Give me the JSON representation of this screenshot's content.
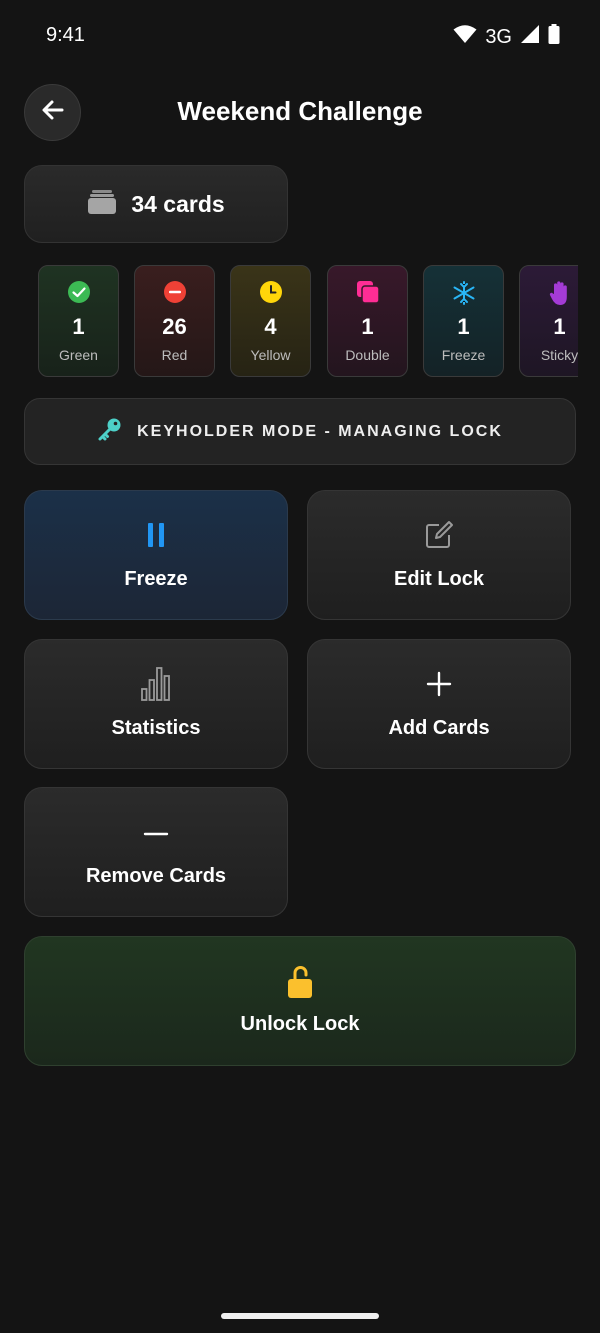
{
  "status": {
    "time": "9:41",
    "network": "3G"
  },
  "header": {
    "title": "Weekend Challenge"
  },
  "deck": {
    "count_label": "34 cards"
  },
  "chips": [
    {
      "count": "1",
      "label": "Green",
      "icon": "check-circle-icon",
      "color": "#3cba54"
    },
    {
      "count": "26",
      "label": "Red",
      "icon": "minus-circle-icon",
      "color": "#ef4136"
    },
    {
      "count": "4",
      "label": "Yellow",
      "icon": "clock-icon",
      "color": "#ffd60a"
    },
    {
      "count": "1",
      "label": "Double",
      "icon": "double-card-icon",
      "color": "#ff2d95"
    },
    {
      "count": "1",
      "label": "Freeze",
      "icon": "snowflake-icon",
      "color": "#29b6f6"
    },
    {
      "count": "1",
      "label": "Sticky",
      "icon": "hand-icon",
      "color": "#a43bd6"
    }
  ],
  "keyholder": {
    "label": "KEYHOLDER MODE - MANAGING LOCK",
    "icon": "key-icon",
    "icon_color": "#4dd0c8"
  },
  "actions": {
    "freeze": {
      "label": "Freeze",
      "icon": "pause-icon",
      "color": "#2196f3"
    },
    "edit_lock": {
      "label": "Edit Lock",
      "icon": "edit-icon"
    },
    "statistics": {
      "label": "Statistics",
      "icon": "bar-chart-icon"
    },
    "add_cards": {
      "label": "Add Cards",
      "icon": "plus-icon"
    },
    "remove_cards": {
      "label": "Remove Cards",
      "icon": "minus-icon"
    },
    "unlock": {
      "label": "Unlock Lock",
      "icon": "unlock-icon",
      "color": "#fbc02d"
    }
  }
}
